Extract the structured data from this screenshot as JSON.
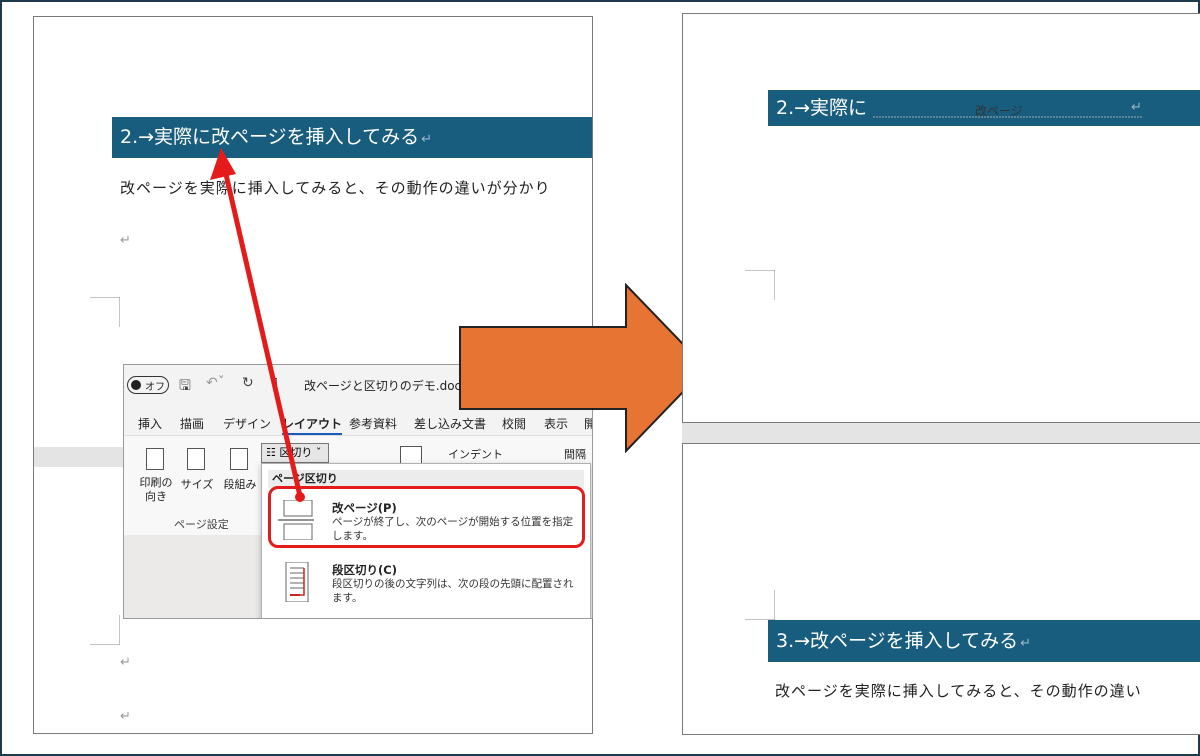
{
  "left_doc": {
    "heading": "2.→実際に改ページを挿入してみる",
    "heading_mark": "↵",
    "body": "改ページを実際に挿入してみると、その動作の違いが分かり",
    "para_mark": "↵"
  },
  "ribbon": {
    "autosave_label": "オフ",
    "doc_title": "改ページと区切りのデモ.docm • 保",
    "tabs": [
      "挿入",
      "描画",
      "デザイン",
      "レイアウト",
      "参考資料",
      "差し込み文書",
      "校閲",
      "表示",
      "開"
    ],
    "active_tab": "レイアウト",
    "buttons": {
      "orientation": "印刷の\n向き",
      "size": "サイズ",
      "columns": "段組み",
      "breaks": "区切り",
      "indent": "インデント",
      "spacing": "間隔"
    },
    "group_label": "ページ設定",
    "dropdown": {
      "header": "ページ区切り",
      "items": [
        {
          "title": "改ページ(P)",
          "desc": "ページが終了し、次のページが開始する位置を指定します。"
        },
        {
          "title": "段区切り(C)",
          "desc": "段区切りの後の文字列は、次の段の先頭に配置されます。"
        }
      ]
    }
  },
  "right_doc": {
    "heading1": "2.→実際に",
    "break_label": "改ページ",
    "heading1_mark": "↵",
    "heading2": "3.→改ページを挿入してみる",
    "heading2_mark": "↵",
    "body": "改ページを実際に挿入してみると、その動作の違い"
  },
  "colors": {
    "heading_bg": "#185d7e",
    "arrow_fill": "#e87433",
    "pointer_red": "#e51b1b"
  }
}
